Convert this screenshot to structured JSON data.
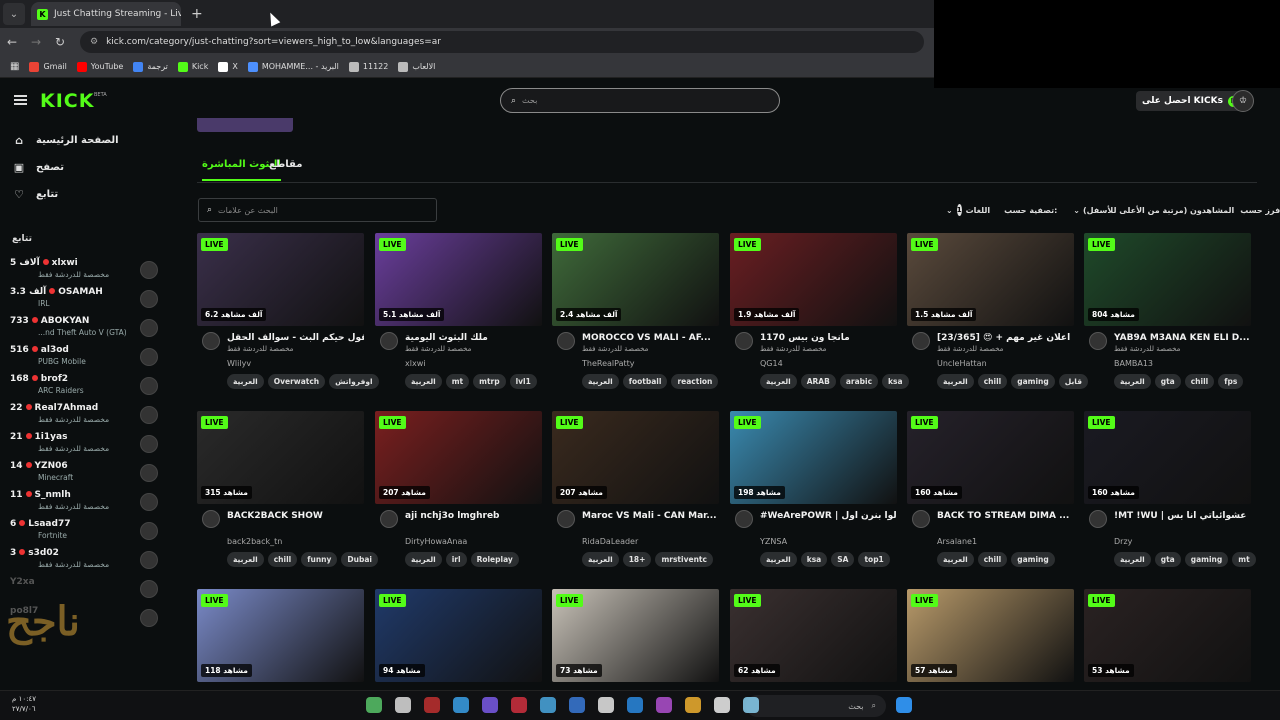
{
  "browser": {
    "tab_title": "Just Chatting Streaming - Live S",
    "url": "kick.com/category/just-chatting?sort=viewers_high_to_low&languages=ar",
    "bookmarks": [
      {
        "label": "Gmail",
        "color": "#ea4335"
      },
      {
        "label": "YouTube",
        "color": "#ff0000"
      },
      {
        "label": "ترجمة",
        "color": "#4285f4"
      },
      {
        "label": "Kick",
        "color": "#53fc18"
      },
      {
        "label": "X",
        "color": "#ffffff"
      },
      {
        "label": "MOHAMME... - البريد",
        "color": "#4d90fe"
      },
      {
        "label": "11122",
        "color": "#bbbbbb"
      },
      {
        "label": "الالعاب",
        "color": "#bbbbbb"
      }
    ]
  },
  "header": {
    "logo": "KICK",
    "beta": "BETA",
    "search_placeholder": "بحث",
    "get_kicks": "احصل على KICKs"
  },
  "sidebar": {
    "nav": [
      {
        "label": "الصفحة الرئيسية",
        "icon": "home-icon",
        "glyph": "⌂"
      },
      {
        "label": "تصفح",
        "icon": "browse-icon",
        "glyph": "▣"
      },
      {
        "label": "تتابع",
        "icon": "heart-icon",
        "glyph": "♡"
      }
    ],
    "following_header": "تتابع",
    "channels": [
      {
        "name": "xlxwi",
        "viewers": "5 آلاف",
        "category": "مخصصة للدردشة فقط"
      },
      {
        "name": "OSAMAH",
        "viewers": "3.3 آلف",
        "category": "IRL"
      },
      {
        "name": "ABOKYAN",
        "viewers": "733",
        "category": "...nd Theft Auto V (GTA)"
      },
      {
        "name": "al3od",
        "viewers": "516",
        "category": "PUBG Mobile"
      },
      {
        "name": "brof2",
        "viewers": "168",
        "category": "ARC Raiders"
      },
      {
        "name": "Real7Ahmad",
        "viewers": "22",
        "category": "مخصصة للدردشة فقط"
      },
      {
        "name": "1i1yas",
        "viewers": "21",
        "category": "مخصصة للدردشة فقط"
      },
      {
        "name": "YZN06",
        "viewers": "14",
        "category": "Minecraft"
      },
      {
        "name": "S_nmlh",
        "viewers": "11",
        "category": "مخصصة للدردشة فقط"
      },
      {
        "name": "Lsaad77",
        "viewers": "6",
        "category": "Fortnite"
      },
      {
        "name": "s3d02",
        "viewers": "3",
        "category": "مخصصة للدردشة فقط"
      },
      {
        "name": "Y2xa",
        "viewers": "",
        "category": ""
      },
      {
        "name": "po8l7",
        "viewers": "",
        "category": ""
      }
    ],
    "watermark": "ناجح"
  },
  "content": {
    "tabs": [
      {
        "label": "البثوث المباشرة"
      },
      {
        "label": "مقاطع"
      }
    ],
    "tag_search_placeholder": "البحث عن علامات",
    "filters": {
      "sort_label": "فرز حسب:",
      "sort_value": "المشاهدون (مرتبة من الأعلى للأسفل)",
      "filter_label": "تصفية حسب:",
      "language_count": "1",
      "language_label": "اللغات"
    },
    "live_badge": "LIVE",
    "streams": [
      {
        "title": "يكرم ويقول حيكم البث - سوالف الحقل...",
        "channel": "Wlilyv",
        "category": "مخصصة للدردشة فقط",
        "viewers": "6.2 آلف مشاهد",
        "tags": [
          "العربية",
          "Overwatch",
          "اوفرواتش"
        ],
        "thumb": "#3a2f4a"
      },
      {
        "title": "ملك البثوث اليومية",
        "channel": "xlxwi",
        "category": "مخصصة للدردشة فقط",
        "viewers": "5.1 آلف مشاهد",
        "tags": [
          "العربية",
          "mt",
          "mtrp",
          "lvl1"
        ],
        "thumb": "#6a3e9c"
      },
      {
        "title": "MOROCCO VS MALI - AF...",
        "channel": "TheRealPatty",
        "category": "مخصصة للدردشة فقط",
        "viewers": "2.4 آلف مشاهد",
        "tags": [
          "العربية",
          "football",
          "reaction"
        ],
        "thumb": "#3f6a3a"
      },
      {
        "title": "1170 مانجا ون بيس",
        "channel": "QG14",
        "category": "مخصصة للدردشة فقط",
        "viewers": "1.9 آلف مشاهد",
        "tags": [
          "العربية",
          "ARAB",
          "arabic",
          "ksa"
        ],
        "thumb": "#6a1e22"
      },
      {
        "title": "[23/365] 😍 + اعلان غير مهم ...",
        "channel": "UncleHattan",
        "category": "مخصصة للدردشة فقط",
        "viewers": "1.5 آلف مشاهد",
        "tags": [
          "العربية",
          "chill",
          "gaming",
          "قابل"
        ],
        "thumb": "#5a4a3c"
      },
      {
        "title": "YAB9A M3ANA KEN ELI D...",
        "channel": "BAMBA13",
        "category": "مخصصة للدردشة فقط",
        "viewers": "804 مشاهد",
        "tags": [
          "العربية",
          "gta",
          "chill",
          "fps"
        ],
        "thumb": "#1f4a2a"
      },
      {
        "title": "BACK2BACK SHOW",
        "channel": "back2back_tn",
        "category": "",
        "viewers": "315 مشاهد",
        "tags": [
          "العربية",
          "chill",
          "funny",
          "Dubai"
        ],
        "thumb": "#2a2a2a"
      },
      {
        "title": "aji nchj3o lmghreb",
        "channel": "DirtyHowaAnaa",
        "category": "",
        "viewers": "207 مشاهد",
        "tags": [
          "العربية",
          "irl",
          "Roleplay"
        ],
        "thumb": "#7a1f1f"
      },
      {
        "title": "Maroc VS Mali - CAN Mar...",
        "channel": "RidaDaLeader",
        "category": "",
        "viewers": "207 مشاهد",
        "tags": [
          "العربية",
          "18+",
          "mrstiventc"
        ],
        "thumb": "#3a2a1e"
      },
      {
        "title": "#WeArePOWR | تعالوا بنرن اول",
        "channel": "YZNSA",
        "category": "",
        "viewers": "198 مشاهد",
        "tags": [
          "العربية",
          "ksa",
          "SA",
          "top1"
        ],
        "thumb": "#3a8ab0"
      },
      {
        "title": "BACK TO STREAM DIMA ...",
        "channel": "Arsalane1",
        "category": "",
        "viewers": "160 مشاهد",
        "tags": [
          "العربية",
          "chill",
          "gaming"
        ],
        "thumb": "#25212a"
      },
      {
        "title": "!MT !WU | عشوائياتي انا بس",
        "channel": "Drzy",
        "category": "",
        "viewers": "160 مشاهد",
        "tags": [
          "العربية",
          "gta",
          "gaming",
          "mt"
        ],
        "thumb": "#1a1a22"
      },
      {
        "title": "",
        "channel": "",
        "category": "",
        "viewers": "118 مشاهد",
        "tags": [],
        "thumb": "#7a8ac8"
      },
      {
        "title": "",
        "channel": "",
        "category": "",
        "viewers": "94 مشاهد",
        "tags": [],
        "thumb": "#203a6a"
      },
      {
        "title": "",
        "channel": "",
        "category": "",
        "viewers": "73 مشاهد",
        "tags": [],
        "thumb": "#c8c2b8"
      },
      {
        "title": "",
        "channel": "",
        "category": "",
        "viewers": "62 مشاهد",
        "tags": [],
        "thumb": "#3a3030"
      },
      {
        "title": "",
        "channel": "",
        "category": "",
        "viewers": "57 مشاهد",
        "tags": [],
        "thumb": "#b89a6a"
      },
      {
        "title": "",
        "channel": "",
        "category": "",
        "viewers": "53 مشاهد",
        "tags": [],
        "thumb": "#2a2222"
      }
    ]
  },
  "taskbar": {
    "time": "١٠:٤٧ م",
    "date": "٢٧/٧/٠٦",
    "search_placeholder": "بحث"
  },
  "colors": {
    "accent": "#53fc18",
    "live_dot": "#e33333"
  }
}
